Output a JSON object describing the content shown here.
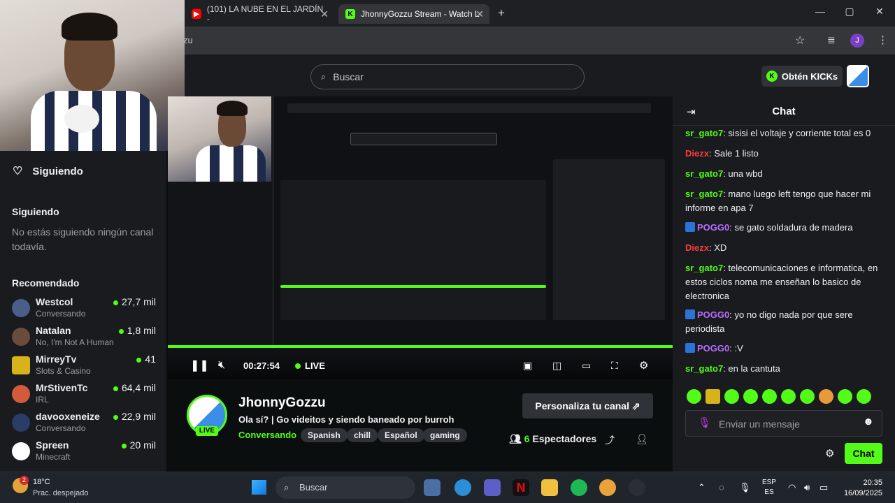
{
  "browser": {
    "tabs": [
      {
        "title": "(101) LA NUBE EN EL JARDÍN -"
      },
      {
        "title": "JhonnyGozzu Stream - Watch L"
      }
    ],
    "new_tab": "+",
    "url": "zu",
    "window": {
      "minimize": "—",
      "maximize": "▢",
      "close": "✕"
    },
    "profile_initial": "J"
  },
  "topnav": {
    "search_placeholder": "Buscar",
    "get_kicks": "Obtén KICKs"
  },
  "sidebar": {
    "following_header": "Siguiendo",
    "following_section": "Siguiendo",
    "empty_text": "No estás siguiendo ningún canal todavía.",
    "recommended_header": "Recomendado",
    "recommended": [
      {
        "name": "Westcol",
        "category": "Conversando",
        "viewers": "27,7 mil",
        "color": "#4a5e8a"
      },
      {
        "name": "Natalan",
        "category": "No, I'm Not A Human",
        "viewers": "1,8 mil",
        "color": "#6b4b3a"
      },
      {
        "name": "MirreyTv",
        "category": "Slots & Casino",
        "viewers": "41",
        "color": "#d8b21a"
      },
      {
        "name": "MrStivenTc",
        "category": "IRL",
        "viewers": "64,4 mil",
        "color": "#d35a3a"
      },
      {
        "name": "davooxeneize",
        "category": "Conversando",
        "viewers": "22,9 mil",
        "color": "#2a3d66"
      },
      {
        "name": "Spreen",
        "category": "Minecraft",
        "viewers": "20 mil",
        "color": "#ffffff"
      }
    ]
  },
  "player": {
    "time": "00:27:54",
    "live": "LIVE",
    "progress": 1.0
  },
  "channel": {
    "name": "JhonnyGozzu",
    "title": "Ola sí? | Go videitos y siendo baneado por burroh",
    "category": "Conversando",
    "tags": [
      "Spanish",
      "chill",
      "Español",
      "gaming"
    ],
    "live_badge": "LIVE",
    "customize": "Personaliza tu canal",
    "viewer_count": "6",
    "viewer_label": "Espectadores"
  },
  "chat": {
    "title": "Chat",
    "messages": [
      {
        "user": "sr_gato7",
        "color": "#53fc18",
        "text": ": sisisi el voltaje y corriente total es 0",
        "badge": false
      },
      {
        "user": "Diezx",
        "color": "#ff3b3b",
        "text": ": Sale 1 listo",
        "badge": false
      },
      {
        "user": "sr_gato7",
        "color": "#53fc18",
        "text": ": una wbd",
        "badge": false
      },
      {
        "user": "sr_gato7",
        "color": "#53fc18",
        "text": ": mano luego left tengo que hacer mi informe en apa 7",
        "badge": false
      },
      {
        "user": "POGG0",
        "color": "#b86bff",
        "text": ": se gato soldadura de madera",
        "badge": true
      },
      {
        "user": "Diezx",
        "color": "#ff3b3b",
        "text": ": XD",
        "badge": false
      },
      {
        "user": "sr_gato7",
        "color": "#53fc18",
        "text": ": telecomunicaciones e informatica, en estos ciclos noma me enseñan lo basico de electronica",
        "badge": false
      },
      {
        "user": "POGG0",
        "color": "#b86bff",
        "text": ": yo no digo nada por que sere periodista",
        "badge": true
      },
      {
        "user": "POGG0",
        "color": "#b86bff",
        "text": ": :V",
        "badge": true
      },
      {
        "user": "sr_gato7",
        "color": "#53fc18",
        "text": ": en la cantuta",
        "badge": false
      }
    ],
    "input_placeholder": "Enviar un mensaje",
    "send": "Chat"
  },
  "taskbar": {
    "temperature": "18°C",
    "weather": "Prac. despejado",
    "weather_badge": "2",
    "search_placeholder": "Buscar",
    "lang_top": "ESP",
    "lang_bottom": "ES",
    "time": "20:35",
    "date": "16/09/2025"
  }
}
